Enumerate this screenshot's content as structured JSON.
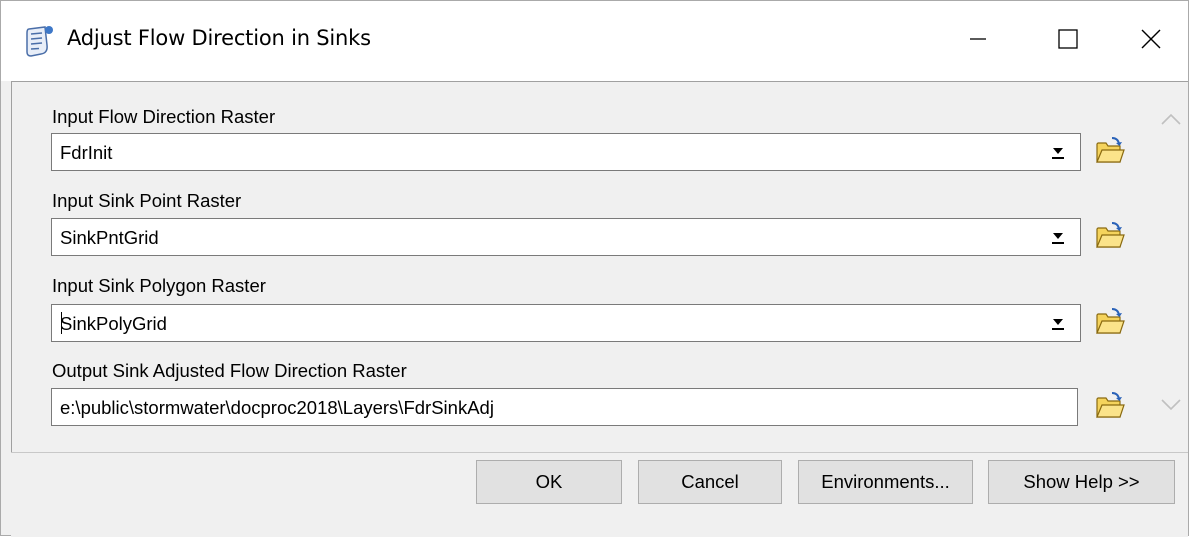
{
  "window": {
    "title": "Adjust Flow Direction in Sinks",
    "controls": {
      "minimize": "minimize-icon",
      "maximize": "maximize-icon",
      "close": "close-icon"
    }
  },
  "parameters": [
    {
      "label": "Input Flow Direction Raster",
      "value": "FdrInit",
      "type": "combo"
    },
    {
      "label": "Input Sink Point Raster",
      "value": "SinkPntGrid",
      "type": "combo"
    },
    {
      "label": "Input Sink Polygon Raster",
      "value": "SinkPolyGrid",
      "type": "combo"
    },
    {
      "label": "Output Sink Adjusted Flow Direction Raster",
      "value": "e:\\public\\stormwater\\docproc2018\\Layers\\FdrSinkAdj",
      "type": "text"
    }
  ],
  "buttons": {
    "ok": "OK",
    "cancel": "Cancel",
    "environments": "Environments...",
    "show_help": "Show Help >>"
  },
  "icons": {
    "title": "script-tool-icon",
    "browse": "open-folder-icon",
    "dropdown": "dropdown-arrow-icon"
  },
  "colors": {
    "dialog_background": "#f0f0f0",
    "titlebar": "#ffffff",
    "button_face": "#e1e1e1",
    "folder_yellow": "#f5d35c"
  }
}
